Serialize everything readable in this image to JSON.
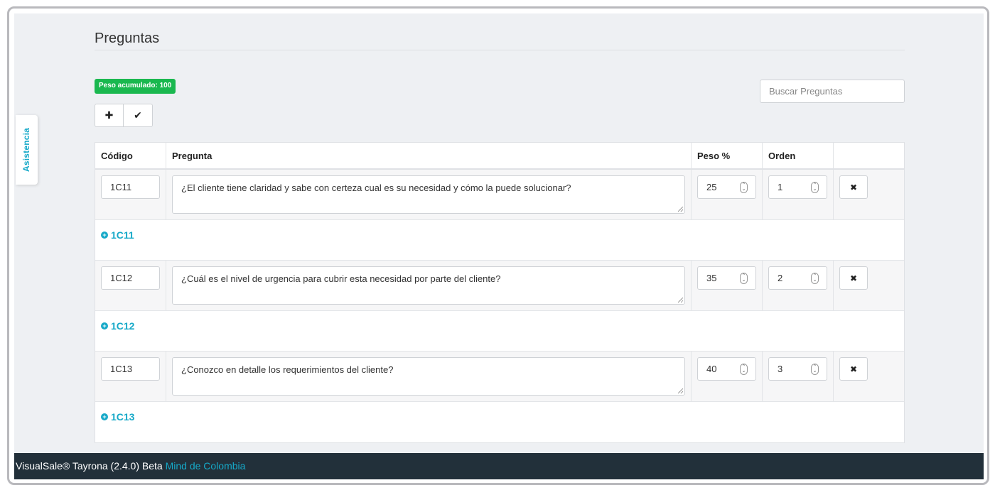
{
  "sidebar_tab": {
    "label": "Asistencia"
  },
  "page": {
    "title": "Preguntas"
  },
  "badge": {
    "text": "Peso acumulado: 100"
  },
  "toolbar": {
    "add_icon": "plus-icon",
    "confirm_icon": "check-icon"
  },
  "search": {
    "placeholder": "Buscar Preguntas",
    "value": ""
  },
  "table": {
    "headers": {
      "code": "Código",
      "question": "Pregunta",
      "weight": "Peso %",
      "order": "Orden",
      "actions": ""
    },
    "rows": [
      {
        "code": "1C11",
        "question": "¿El cliente tiene claridad y sabe con certeza cual es su necesidad y cómo la puede solucionar?",
        "weight": "25",
        "order": "1",
        "link": "1C11"
      },
      {
        "code": "1C12",
        "question": "¿Cuál es el nivel de urgencia para cubrir esta necesidad por parte del cliente?",
        "weight": "35",
        "order": "2",
        "link": "1C12"
      },
      {
        "code": "1C13",
        "question": "¿Conozco en detalle los requerimientos del cliente?",
        "weight": "40",
        "order": "3",
        "link": "1C13"
      }
    ]
  },
  "footer": {
    "product": "VisualSale® Tayrona (2.4.0) Beta",
    "company": "Mind de Colombia"
  },
  "colors": {
    "accent": "#16a9c8",
    "badge": "#1ab84f",
    "footer_bg": "#22303a"
  }
}
